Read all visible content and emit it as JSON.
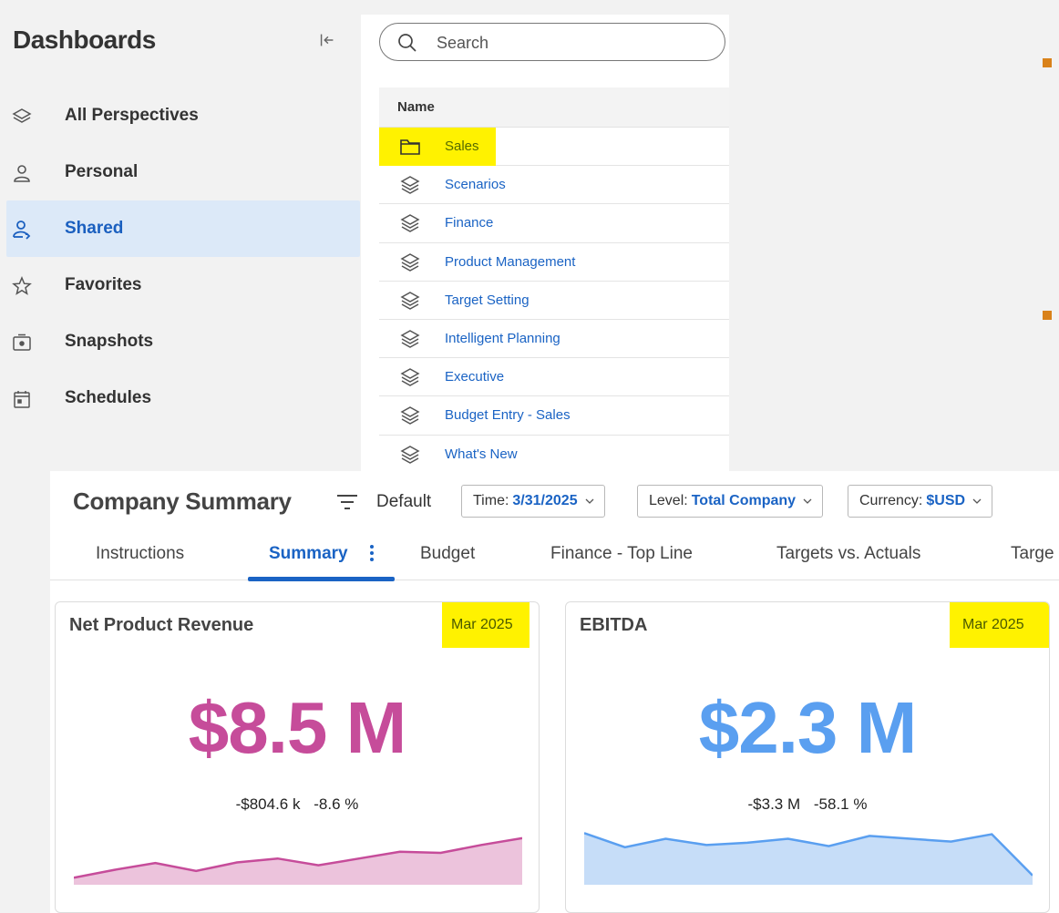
{
  "sidebar": {
    "title": "Dashboards",
    "items": [
      {
        "label": "All Perspectives",
        "icon": "layers-icon",
        "active": false
      },
      {
        "label": "Personal",
        "icon": "person-icon",
        "active": false
      },
      {
        "label": "Shared",
        "icon": "shared-person-icon",
        "active": true
      },
      {
        "label": "Favorites",
        "icon": "star-icon",
        "active": false
      },
      {
        "label": "Snapshots",
        "icon": "camera-icon",
        "active": false
      },
      {
        "label": "Schedules",
        "icon": "calendar-icon",
        "active": false
      }
    ]
  },
  "list": {
    "search_placeholder": "Search",
    "column_header": "Name",
    "rows": [
      {
        "label": "Sales",
        "icon": "folder-icon"
      },
      {
        "label": "Scenarios",
        "icon": "layers-icon"
      },
      {
        "label": "Finance",
        "icon": "layers-icon"
      },
      {
        "label": "Product Management",
        "icon": "layers-icon"
      },
      {
        "label": "Target Setting",
        "icon": "layers-icon"
      },
      {
        "label": "Intelligent Planning",
        "icon": "layers-icon"
      },
      {
        "label": "Executive",
        "icon": "layers-icon"
      },
      {
        "label": "Budget Entry - Sales",
        "icon": "layers-icon"
      },
      {
        "label": "What's New",
        "icon": "layers-icon"
      }
    ]
  },
  "summary": {
    "title": "Company Summary",
    "view": "Default",
    "filters": {
      "time_key": "Time:",
      "time_val": "3/31/2025",
      "level_key": "Level:",
      "level_val": "Total Company",
      "currency_key": "Currency:",
      "currency_val": "$USD"
    },
    "tabs": [
      "Instructions",
      "Summary",
      "Budget",
      "Finance - Top Line",
      "Targets vs. Actuals",
      "Targe"
    ],
    "active_tab": "Summary"
  },
  "cards": [
    {
      "title": "Net Product Revenue",
      "period": "Mar 2025",
      "value": "$8.5 M",
      "delta_abs": "-$804.6 k",
      "delta_pct": "-8.6 %",
      "color": "#c64c9a",
      "fill": "#ecc3dc",
      "trend": [
        0.06,
        0.2,
        0.32,
        0.18,
        0.33,
        0.4,
        0.28,
        0.4,
        0.52,
        0.5,
        0.64,
        0.76
      ]
    },
    {
      "title": "EBITDA",
      "period": "Mar 2025",
      "value": "$2.3 M",
      "delta_abs": "-$3.3 M",
      "delta_pct": "-58.1 %",
      "color": "#5a9ff0",
      "fill": "#c6ddf8",
      "trend": [
        0.85,
        0.6,
        0.75,
        0.64,
        0.68,
        0.75,
        0.62,
        0.8,
        0.75,
        0.7,
        0.83,
        0.1
      ]
    }
  ],
  "colors": {
    "accent": "#1a63c4",
    "highlight": "#fff200",
    "active_bg": "#dce9f8",
    "marker": "#d9821a"
  }
}
